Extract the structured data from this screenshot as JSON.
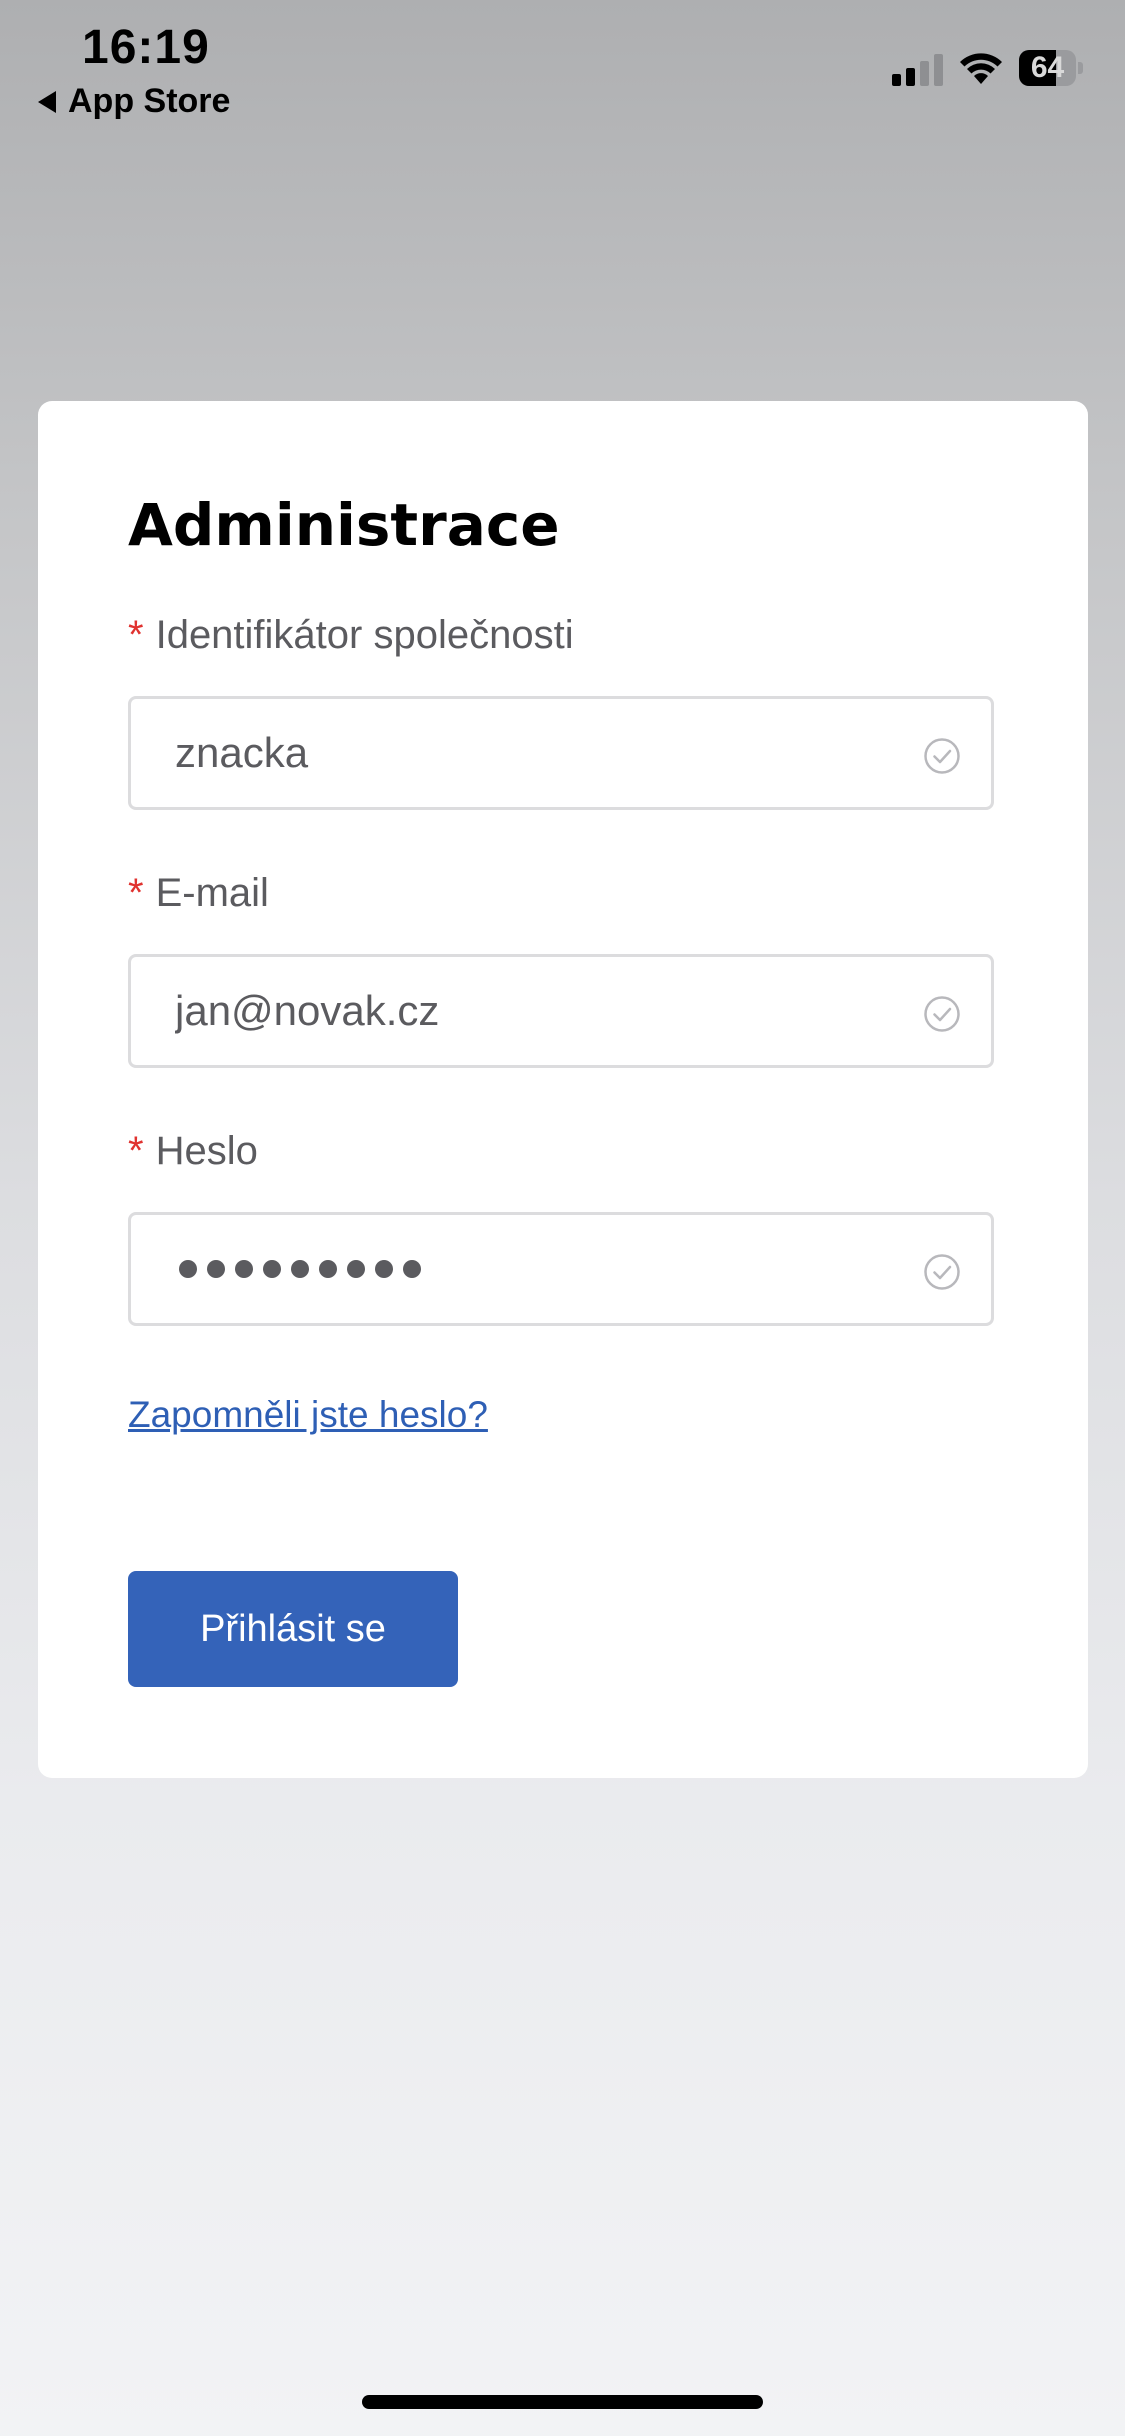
{
  "status_bar": {
    "time": "16:19",
    "back_label": "App Store",
    "battery_level": "64",
    "battery_percent": 64
  },
  "form": {
    "title": "Administrace",
    "required_mark": "*",
    "company": {
      "label": "Identifikátor společnosti",
      "value": "znacka"
    },
    "email": {
      "label": "E-mail",
      "value": "jan@novak.cz"
    },
    "password": {
      "label": "Heslo",
      "masked_length": 9
    },
    "forgot_link": "Zapomněli jste heslo?",
    "submit_label": "Přihlásit se"
  },
  "colors": {
    "accent": "#3463b9",
    "link": "#2e5fb5",
    "required": "#e0322f",
    "valid_icon": "#b8b8bc"
  },
  "icons": {
    "back": "back-triangle-icon",
    "signal": "cellular-signal-icon",
    "wifi": "wifi-icon",
    "battery": "battery-icon",
    "valid": "check-circle-icon"
  }
}
